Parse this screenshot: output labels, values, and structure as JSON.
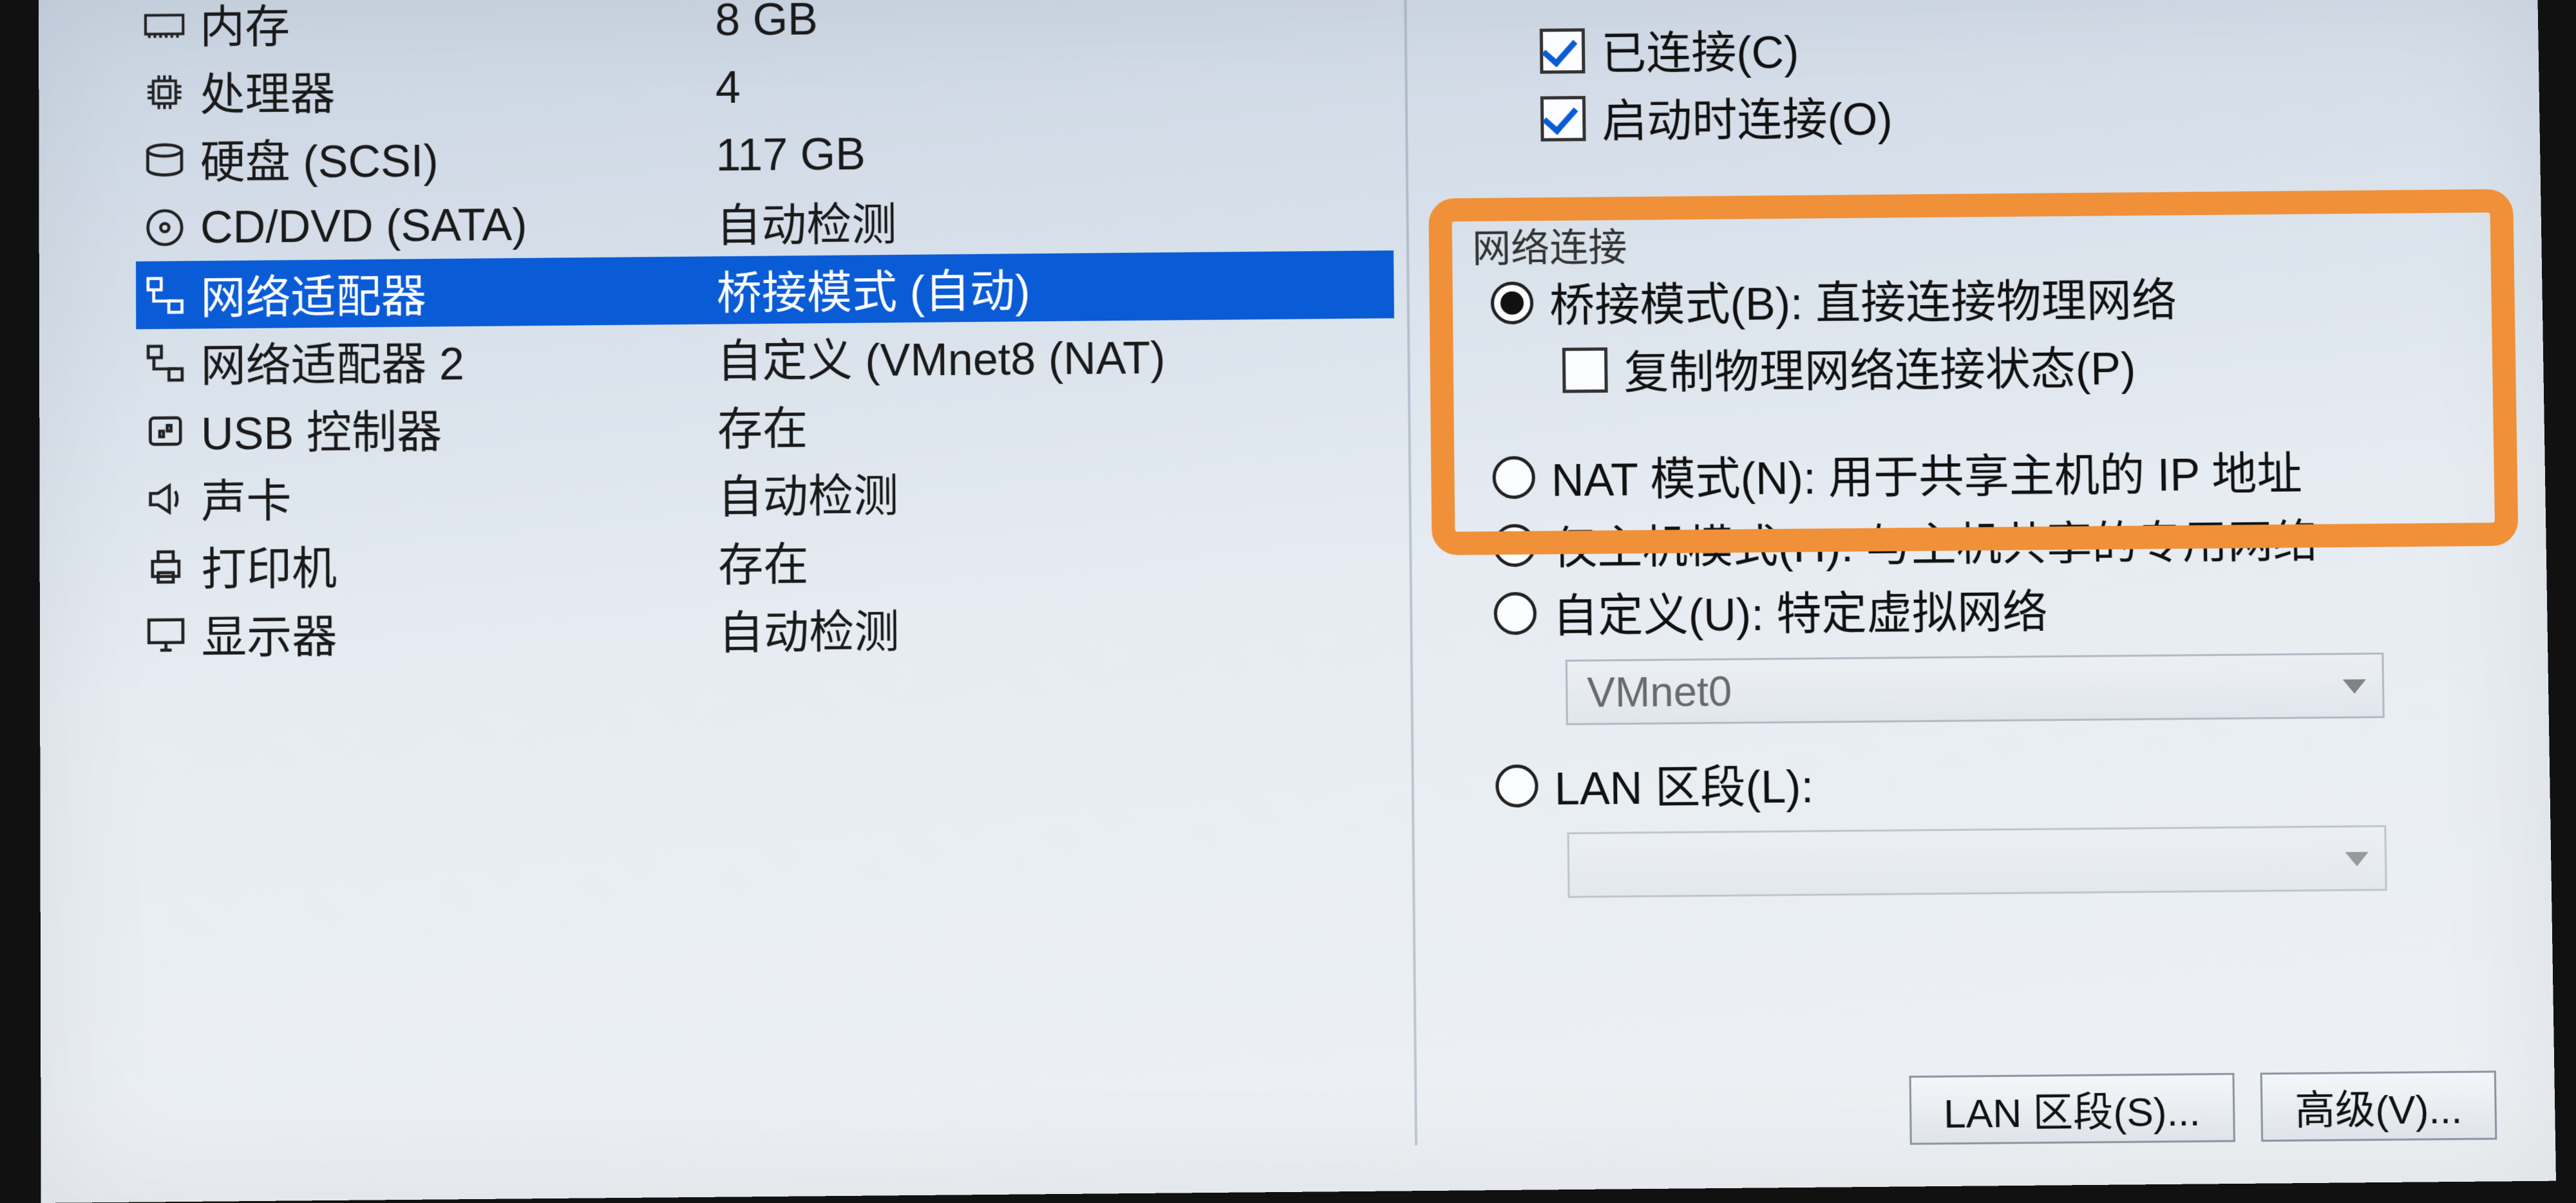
{
  "hardware": [
    {
      "key": "memory",
      "name": "内存",
      "value": "8 GB"
    },
    {
      "key": "cpu",
      "name": "处理器",
      "value": "4"
    },
    {
      "key": "hdd",
      "name": "硬盘 (SCSI)",
      "value": "117 GB"
    },
    {
      "key": "cd",
      "name": "CD/DVD (SATA)",
      "value": "自动检测"
    },
    {
      "key": "net1",
      "name": "网络适配器",
      "value": "桥接模式 (自动)"
    },
    {
      "key": "net2",
      "name": "网络适配器 2",
      "value": "自定义 (VMnet8 (NAT)"
    },
    {
      "key": "usb",
      "name": "USB 控制器",
      "value": "存在"
    },
    {
      "key": "sound",
      "name": "声卡",
      "value": "自动检测"
    },
    {
      "key": "printer",
      "name": "打印机",
      "value": "存在"
    },
    {
      "key": "display",
      "name": "显示器",
      "value": "自动检测"
    }
  ],
  "device_state": {
    "connected": "已连接(C)",
    "connect_at_start": "启动时连接(O)"
  },
  "netconn": {
    "title": "网络连接",
    "bridge": "桥接模式(B): 直接连接物理网络",
    "replicate": "复制物理网络连接状态(P)",
    "nat": "NAT 模式(N): 用于共享主机的 IP 地址",
    "hostonly": "仅主机模式(H): 与主机共享的专用网络",
    "custom": "自定义(U): 特定虚拟网络",
    "custom_value": "VMnet0",
    "lan": "LAN 区段(L):",
    "lan_value": ""
  },
  "buttons": {
    "lan_segments": "LAN 区段(S)...",
    "advanced": "高级(V)..."
  }
}
